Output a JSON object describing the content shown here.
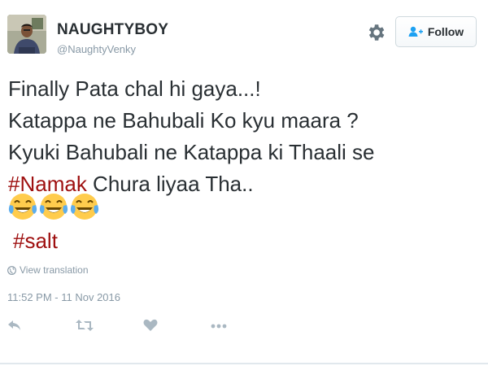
{
  "user": {
    "display_name": "NAUGHTYBOY",
    "screen_name": "@NaughtyVenky"
  },
  "header": {
    "follow_label": "Follow",
    "gear_icon": "gear-icon"
  },
  "tweet": {
    "lines": [
      "Finally Pata chal hi gaya...!",
      "Katappa ne Bahubali Ko kyu maara ?",
      "Kyuki Bahubali ne Katappa ki Thaali se"
    ],
    "line4_hashtag": "#Namak",
    "line4_rest": " Chura liyaa Tha..",
    "emojis": [
      "😂",
      "😂",
      "😂"
    ],
    "hashtag2": "#salt"
  },
  "view_translation": "View translation",
  "timestamp": "11:52 PM - 11 Nov 2016",
  "actions": [
    "reply-icon",
    "retweet-icon",
    "like-icon",
    "more-icon"
  ],
  "colors": {
    "hashtag": "#9e0f0f",
    "meta_text": "#8899a6",
    "body_text": "#292f33",
    "emoji_face": "#ffcc4d"
  }
}
